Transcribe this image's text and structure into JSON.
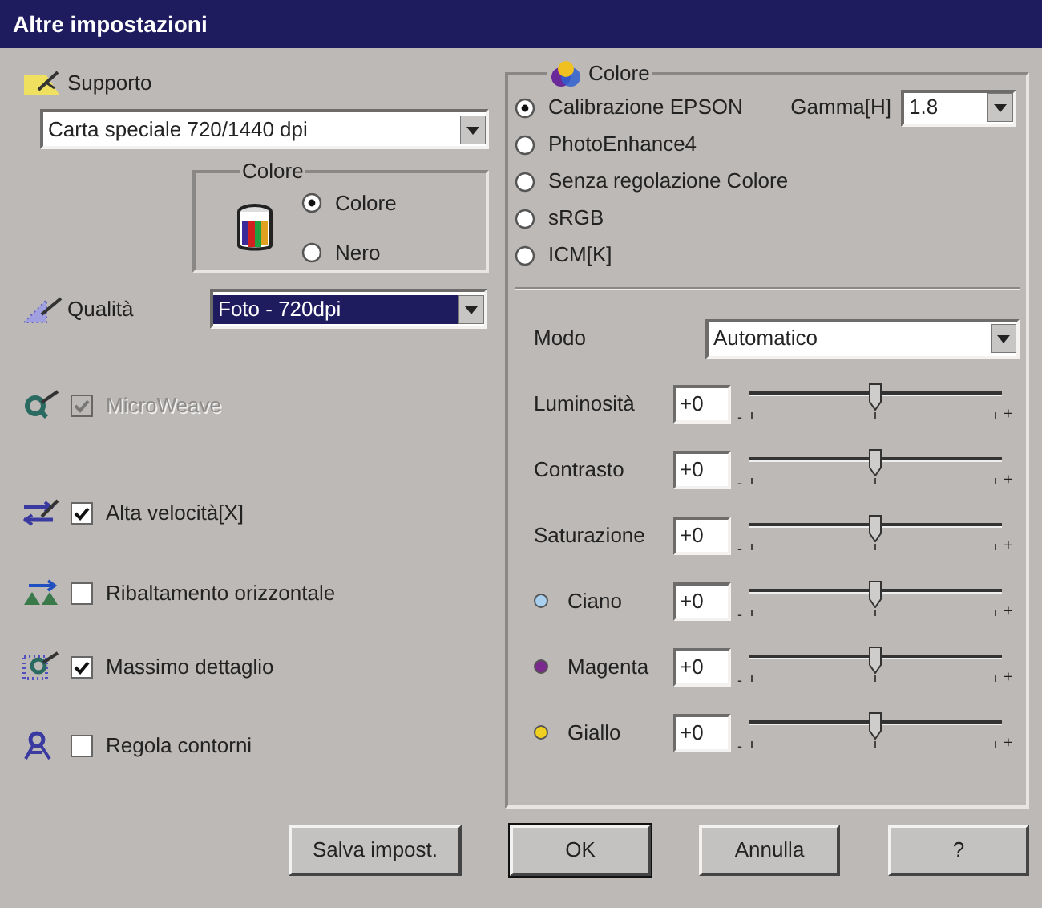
{
  "window": {
    "title": "Altre impostazioni"
  },
  "media": {
    "label": "Supporto",
    "value": "Carta speciale 720/1440 dpi"
  },
  "ink": {
    "title": "Colore",
    "options": [
      {
        "label": "Colore",
        "selected": true
      },
      {
        "label": "Nero",
        "selected": false
      }
    ]
  },
  "quality": {
    "label": "Qualità",
    "value": "Foto - 720dpi",
    "highlighted": true
  },
  "options": [
    {
      "label": "MicroWeave",
      "checked": true,
      "disabled": true
    },
    {
      "label": "Alta velocità[X]",
      "checked": true,
      "disabled": false
    },
    {
      "label": "Ribaltamento orizzontale",
      "checked": false,
      "disabled": false
    },
    {
      "label": "Massimo dettaglio",
      "checked": true,
      "disabled": false
    },
    {
      "label": "Regola contorni",
      "checked": false,
      "disabled": false
    }
  ],
  "color_panel": {
    "title": "Colore",
    "modes": [
      {
        "label": "Calibrazione EPSON",
        "selected": true
      },
      {
        "label": "PhotoEnhance4",
        "selected": false
      },
      {
        "label": "Senza regolazione Colore",
        "selected": false
      },
      {
        "label": "sRGB",
        "selected": false
      },
      {
        "label": "ICM[K]",
        "selected": false
      }
    ],
    "gamma": {
      "label": "Gamma[H]",
      "value": "1.8"
    },
    "mode": {
      "label": "Modo",
      "value": "Automatico"
    },
    "sliders": [
      {
        "label": "Luminosità",
        "value": "+0",
        "level": 0.5,
        "min_mark": "-",
        "max_mark": "+"
      },
      {
        "label": "Contrasto",
        "value": "+0",
        "level": 0.5,
        "min_mark": "-",
        "max_mark": "+"
      },
      {
        "label": "Saturazione",
        "value": "+0",
        "level": 0.5,
        "min_mark": "-",
        "max_mark": "+"
      },
      {
        "label": "Ciano",
        "value": "+0",
        "level": 0.5,
        "min_mark": "-",
        "max_mark": "+",
        "color": "#a8d0ee"
      },
      {
        "label": "Magenta",
        "value": "+0",
        "level": 0.5,
        "min_mark": "-",
        "max_mark": "+",
        "color": "#7a2a8c"
      },
      {
        "label": "Giallo",
        "value": "+0",
        "level": 0.5,
        "min_mark": "-",
        "max_mark": "+",
        "color": "#f0d020"
      }
    ]
  },
  "buttons": [
    {
      "label": "Salva impost.",
      "default": false
    },
    {
      "label": "OK",
      "default": true
    },
    {
      "label": "Annulla",
      "default": false
    },
    {
      "label": "?",
      "default": false
    }
  ]
}
